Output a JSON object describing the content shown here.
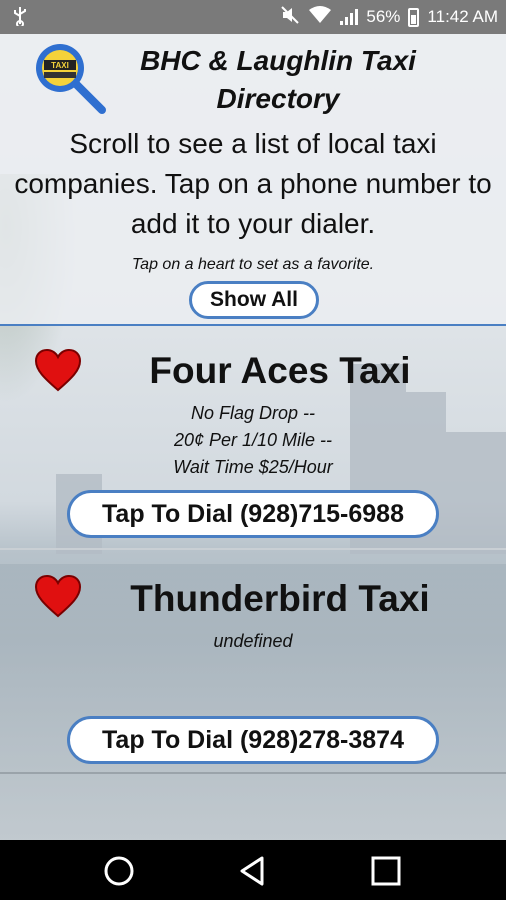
{
  "status_bar": {
    "battery": "56%",
    "time": "11:42 AM"
  },
  "header": {
    "title": "BHC & Laughlin Taxi Directory",
    "logo_text": "TAXI",
    "intro": "Scroll to see a list of local taxi companies. Tap on a phone number to add it to your dialer.",
    "hint": "Tap on a heart to set as a favorite.",
    "show_all_label": "Show All"
  },
  "companies": [
    {
      "name": "Four Aces Taxi",
      "desc_lines": [
        "No Flag Drop --",
        "20¢ Per 1/10 Mile --",
        "Wait Time $25/Hour"
      ],
      "dial_label": "Tap To Dial (928)715-6988"
    },
    {
      "name": "Thunderbird Taxi",
      "desc_lines": [
        "undefined"
      ],
      "dial_label": "Tap To Dial (928)278-3874"
    }
  ],
  "colors": {
    "accent": "#4a7fc3",
    "heart": "#e01010",
    "status_bar": "#7a7a7a",
    "nav_bar": "#000000"
  },
  "icons": [
    "usb-icon",
    "mute-icon",
    "wifi-icon",
    "signal-icon",
    "battery-icon",
    "taxi-search-logo",
    "heart-icon",
    "home-icon",
    "back-icon",
    "recents-icon"
  ]
}
